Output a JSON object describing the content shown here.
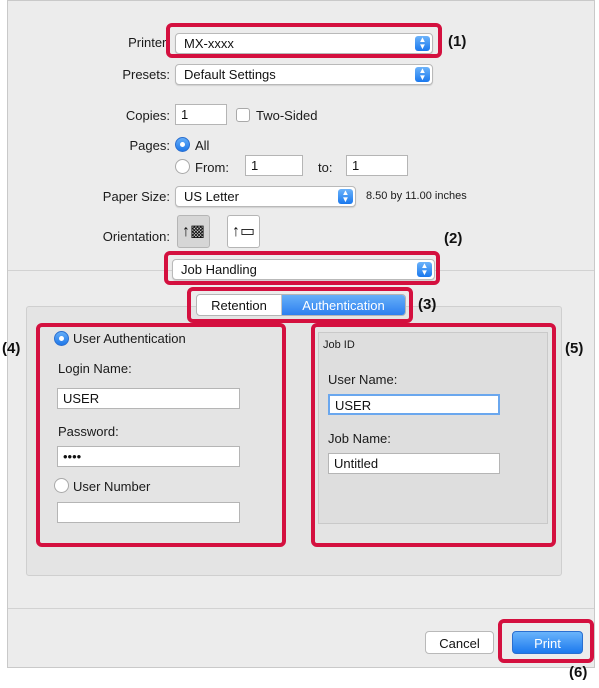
{
  "printer": {
    "label": "Printer:",
    "value": "MX-xxxx"
  },
  "presets": {
    "label": "Presets:",
    "value": "Default Settings"
  },
  "copies": {
    "label": "Copies:",
    "value": "1",
    "two_sided_label": "Two-Sided"
  },
  "pages": {
    "label": "Pages:",
    "all_label": "All",
    "from_label": "From:",
    "from_value": "1",
    "to_label": "to:",
    "to_value": "1",
    "selected": "All"
  },
  "paper_size": {
    "label": "Paper Size:",
    "value": "US Letter",
    "dimensions": "8.50 by 11.00 inches"
  },
  "orientation": {
    "label": "Orientation:",
    "selected": "portrait"
  },
  "section_popup": {
    "value": "Job Handling"
  },
  "tabs": [
    {
      "label": "Retention",
      "selected": false
    },
    {
      "label": "Authentication",
      "selected": true
    }
  ],
  "auth": {
    "user_auth_label": "User Authentication",
    "login_name_label": "Login Name:",
    "login_name_value": "USER",
    "password_label": "Password:",
    "password_value": "••••",
    "user_number_label": "User Number",
    "user_number_value": ""
  },
  "job_id": {
    "title": "Job ID",
    "user_name_label": "User Name:",
    "user_name_value": "USER",
    "job_name_label": "Job Name:",
    "job_name_value": "Untitled"
  },
  "buttons": {
    "cancel": "Cancel",
    "print": "Print"
  },
  "callouts": {
    "c1": "(1)",
    "c2": "(2)",
    "c3": "(3)",
    "c4": "(4)",
    "c5": "(5)",
    "c6": "(6)"
  },
  "colors": {
    "accent": "#1a78ee",
    "callout_box": "#d4103f"
  },
  "icons": {
    "popup_arrow": "up-down-chevron-icon",
    "orientation_portrait": "portrait-icon",
    "orientation_landscape": "landscape-icon"
  }
}
